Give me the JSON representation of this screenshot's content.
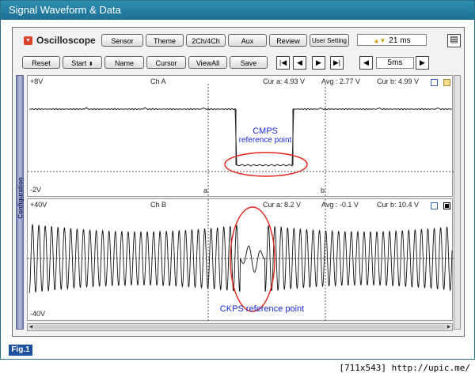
{
  "window": {
    "title": "Signal Waveform & Data"
  },
  "app": {
    "name": "Oscilloscope"
  },
  "toolbar1": {
    "sensor": "Sensor",
    "theme": "Theme",
    "channels": "2Ch/4Ch",
    "aux": "Aux",
    "review": "Review",
    "user_setting": "User Setting",
    "time_readout": "21 ms"
  },
  "toolbar2": {
    "reset": "Reset",
    "start": "Start",
    "name": "Name",
    "cursor": "Cursor",
    "view_all": "ViewAll",
    "save": "Save",
    "first": "|◀",
    "prev": "◀",
    "next": "▶",
    "last": "▶|",
    "time_scale": "5ms",
    "scale_down": "◀",
    "scale_up": "▶"
  },
  "sidebar": {
    "label": "Configuration"
  },
  "channel_a": {
    "name": "Ch A",
    "top": "+8V",
    "bottom": "-2V",
    "cur_a": "Cur a: 4.93 V",
    "avg": "Avg :  2.77 V",
    "cur_b": "Cur b: 4.99 V",
    "cursor_a": "a",
    "cursor_b": "b",
    "annotation_line1": "CMPS",
    "annotation_line2": "reference point"
  },
  "channel_b": {
    "name": "Ch B",
    "top": "+40V",
    "bottom": "-40V",
    "cur_a": "Cur a: 8.2 V",
    "avg": "Avg :  -0.1 V",
    "cur_b": "Cur b: 10.4 V",
    "annotation": "CKPS reference point"
  },
  "footer": {
    "figure": "Fig.1"
  },
  "watermark": "[711x543] http://upic.me/",
  "colors": {
    "title_bar": "#1f7ba3",
    "annotation": "#1b2bd6",
    "ellipse": "#e0261b",
    "rail": "#8a90c4"
  }
}
